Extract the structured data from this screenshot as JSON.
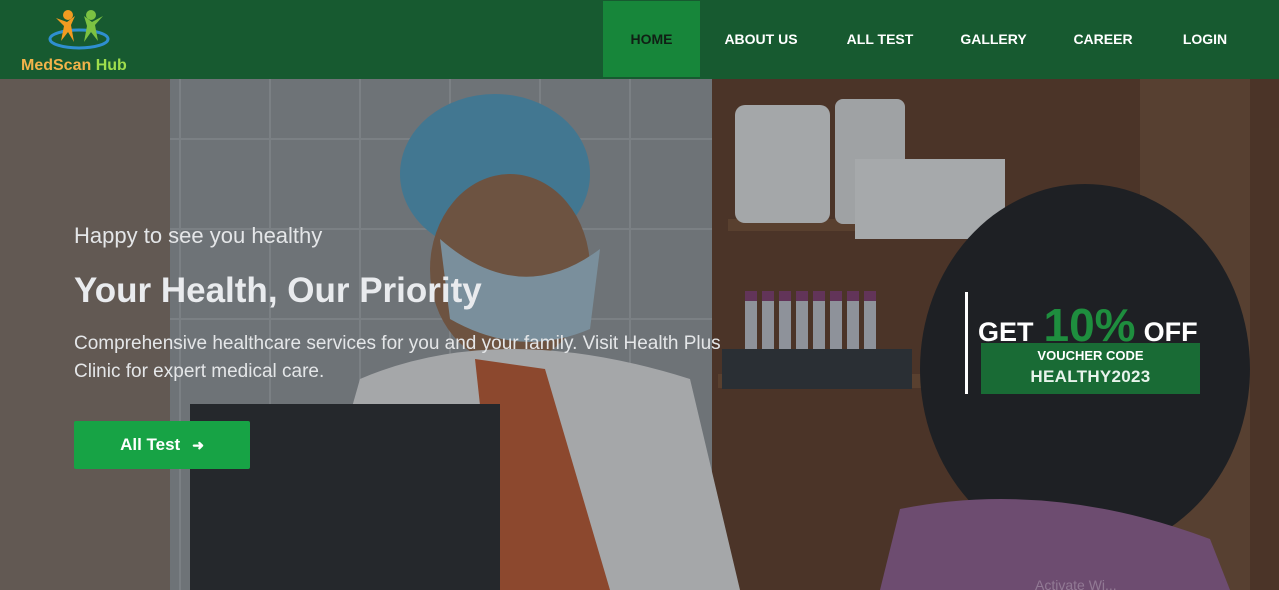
{
  "brand": {
    "name_part1": "MedScan",
    "name_part2": "Hub"
  },
  "nav": {
    "items": [
      {
        "label": "HOME",
        "active": true
      },
      {
        "label": "ABOUT US",
        "active": false
      },
      {
        "label": "ALL TEST",
        "active": false
      },
      {
        "label": "GALLERY",
        "active": false
      },
      {
        "label": "CAREER",
        "active": false
      },
      {
        "label": "LOGIN",
        "active": false
      }
    ]
  },
  "hero": {
    "subtitle": "Happy to see you healthy",
    "title": "Your Health, Our Priority",
    "description": "Comprehensive healthcare services for you and your family. Visit Health Plus Clinic for expert medical care.",
    "button_label": "All Test",
    "button_icon": "arrow-right-icon"
  },
  "voucher": {
    "prefix": "GET",
    "percent": "10%",
    "suffix": "OFF",
    "label": "VOUCHER CODE",
    "code": "HEALTHY2023"
  },
  "watermark": "Activate Wi...",
  "colors": {
    "nav_bg": "#175a30",
    "nav_active": "#17863a",
    "button_green": "#17a345",
    "voucher_green": "#196b35"
  }
}
